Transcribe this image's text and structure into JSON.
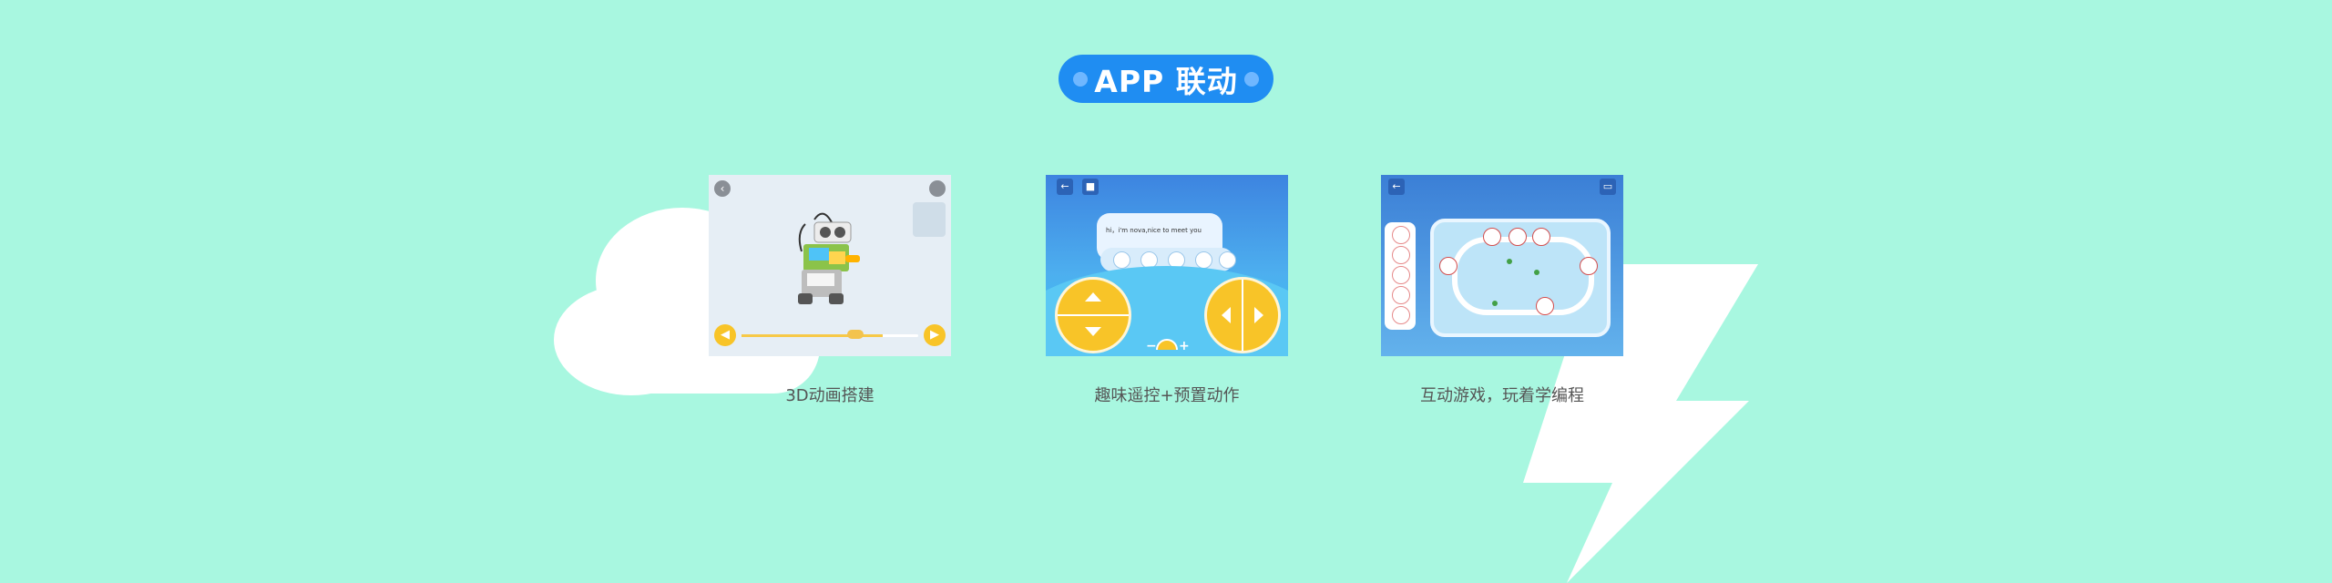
{
  "header": {
    "title": "APP 联动"
  },
  "cards": [
    {
      "caption": "3D动画搭建"
    },
    {
      "caption": "趣味遥控+预置动作",
      "bubble_text": "hi，i'm nova,nice to meet you"
    },
    {
      "caption": "互动游戏，玩着学编程"
    }
  ],
  "colors": {
    "background": "#a8f7e0",
    "accent": "#1f8df2",
    "yellow": "#f8c428"
  }
}
